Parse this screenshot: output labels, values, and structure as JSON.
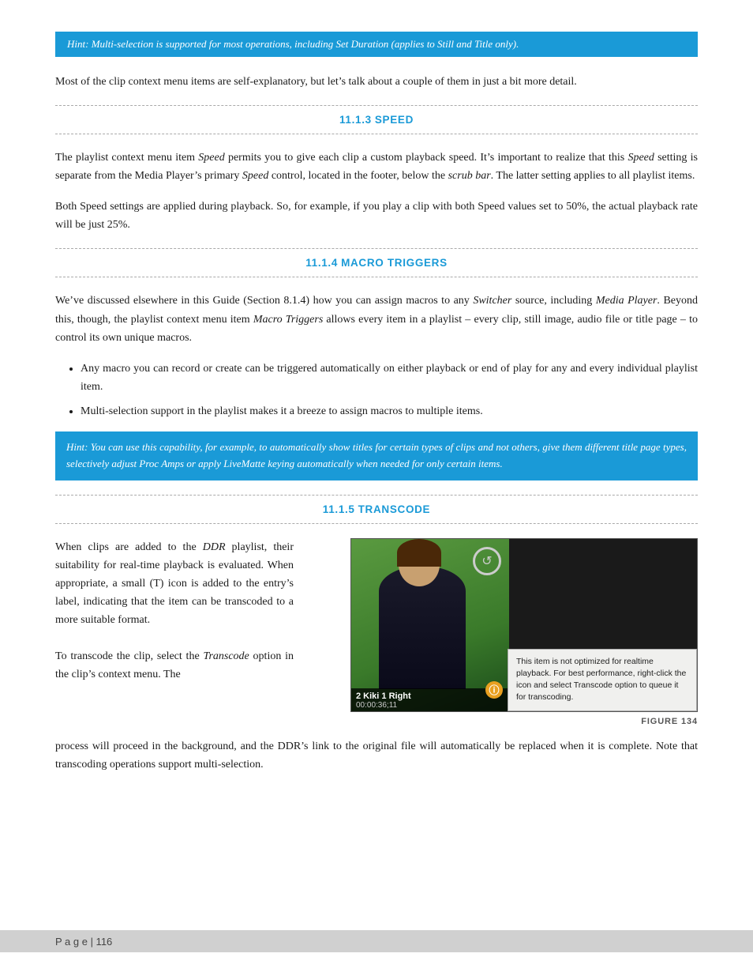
{
  "hint1": {
    "text": "Hint: Multi-selection is supported for most operations, including Set Duration (applies to Still and Title only)."
  },
  "intro_text": "Most of the clip context menu items are self-explanatory, but let’s talk about a couple of them in just a bit more detail.",
  "section_speed": {
    "number": "11.1.3",
    "label": "SPEED",
    "p1": "The playlist context menu item Speed permits you to give each clip a custom playback speed.  It’s important to realize that this Speed setting is separate from the Media Player’s primary Speed control, located in the footer, below the scrub bar.  The latter setting applies to all playlist items.",
    "p2": "Both Speed settings are applied during playback.  So, for example, if you play a clip with both Speed values set to 50%, the actual playback rate will be just 25%."
  },
  "section_macro": {
    "number": "11.1.4",
    "label": "MACRO TRIGGERS",
    "p1": "We’ve discussed elsewhere in this Guide (Section 8.1.4) how you can assign macros to any Switcher source, including Media Player.  Beyond this, though, the playlist context menu item Macro Triggers allows every item in a playlist – every clip, still image, audio file or title page – to control its own unique macros.",
    "bullet1": "Any macro you can record or create can be triggered automatically on either playback or end of play for any and every individual playlist item.",
    "bullet2": "Multi-selection support in the playlist makes it a breeze to assign macros to multiple items.",
    "hint2": "Hint: You can use this capability, for example, to automatically show titles for certain types of clips and not others, give them different title page types, selectively adjust Proc Amps or apply LiveMatte keying automatically when needed for only certain items."
  },
  "section_transcode": {
    "number": "11.1.5",
    "label": "TRANSCODE",
    "p1": "When clips are added to the DDR playlist, their suitability for real-time playback is evaluated. When appropriate, a small (T) icon is added to the entry’s label, indicating that the item can be transcoded to a more suitable format.",
    "p2": "To transcode the clip, select the Transcode option in the clip’s context menu. The",
    "p3": "process will proceed in the background, and the DDR’s link to the original file will automatically be replaced when it is complete.  Note that transcoding operations support multi-selection.",
    "figure": {
      "caption": "FIGURE 134",
      "video_title": "2  Kiki 1 Right",
      "video_time": "00:00:36;11",
      "tooltip": "This item is not optimized for realtime playback. For best performance, right-click the icon and select Transcode option to queue it for transcoding."
    }
  },
  "footer": {
    "text": "P a g e  |  116"
  }
}
